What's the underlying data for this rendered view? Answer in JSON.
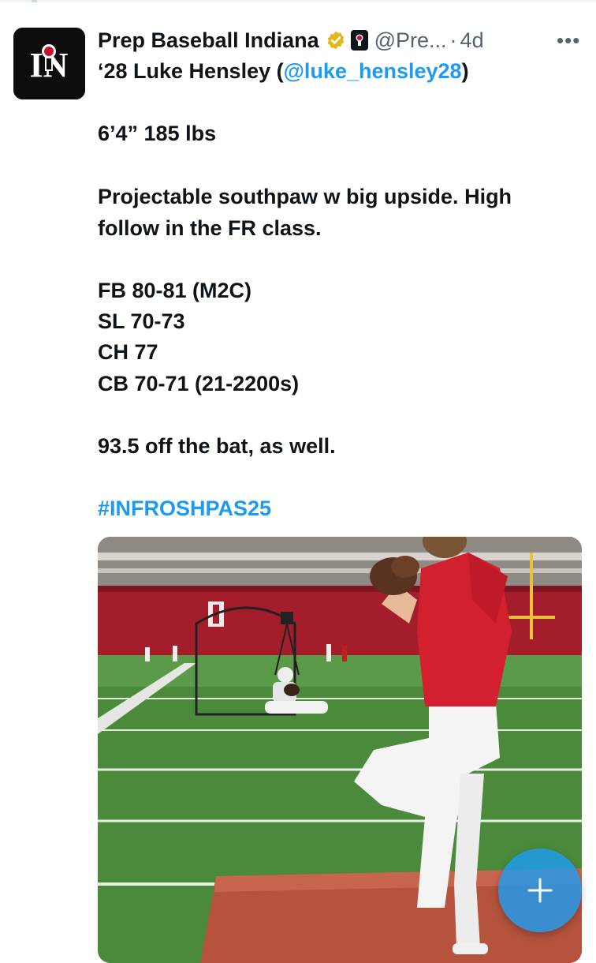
{
  "tweet": {
    "author_name": "Prep Baseball Indiana",
    "handle": "@Pre...",
    "separator": "·",
    "time": "4d",
    "more_label": "•••",
    "avatar_text": "IN",
    "line1_prefix": "‘28 Luke Hensley (",
    "line1_mention": "@luke_hensley28",
    "line1_suffix": ")",
    "size": "6’4” 185 lbs",
    "desc_line1": "Projectable southpaw w big upside. High",
    "desc_line2": "follow in the FR class.",
    "pitches": [
      "FB 80-81 (M2C)",
      "SL 70-73",
      "CH 77",
      "CB 70-71 (21-2200s)"
    ],
    "exit_velo": "93.5 off the bat, as well.",
    "hashtag": "#INFROSHPAS25"
  },
  "colors": {
    "accent": "#1d9bf0",
    "verified_gold": "#e2b719",
    "text": "#0f1419",
    "secondary": "#536471"
  },
  "icons": {
    "verified": "verified-badge-icon",
    "affiliate": "affiliate-badge-icon",
    "more": "more-icon",
    "compose": "plus-icon"
  }
}
